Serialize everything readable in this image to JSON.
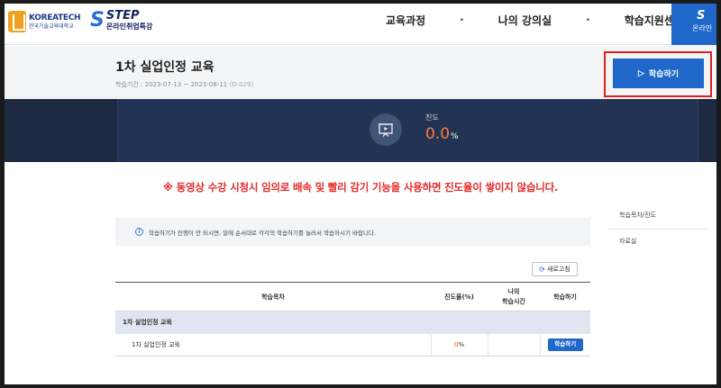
{
  "header": {
    "brand1_en": "KOREATECH",
    "brand1_ko": "한국기술교육대학교",
    "brand2_en": "STEP",
    "brand2_ko": "온라인취업특강",
    "nav": [
      "교육과정",
      "·",
      "나의 강의실",
      "·",
      "학습지원센터"
    ],
    "aside_label": "온라인"
  },
  "course": {
    "title": "1차 실업인정 교육",
    "period": "학습기간 : 2023-07-13 ~ 2023-08-11",
    "dday": "(D-029)",
    "study_button": "학습하기"
  },
  "progress": {
    "label": "진도",
    "value": "0.0",
    "unit": "%"
  },
  "notice": {
    "warning": "※ 동영상 수강 시청시 임의로 배속 및 빨리 감기 기능을 사용하면 진도율이 쌓이지 않습니다.",
    "info": "학습하기가 진행이 안 되시면, 밑에 순서대로 각각의 학습하기를 눌러서 학습하시기 바랍니다."
  },
  "side_menu": [
    "학습목차/진도",
    "자료실"
  ],
  "toc": {
    "refresh": "새로고침",
    "columns": {
      "title": "학습목차",
      "rate": "진도율(%)",
      "time_line1": "나의",
      "time_line2": "학습시간",
      "action": "학습하기"
    },
    "group": "1차 실업인정 교육",
    "rows": [
      {
        "title": "1차 실업인정 교육",
        "rate": "0",
        "rate_unit": "%",
        "time": "",
        "button": "학습하기"
      }
    ]
  },
  "colors": {
    "accent": "#1f67c9",
    "warning": "#e52b2b",
    "progress_value": "#ff7a3d",
    "band": "#1d2a42"
  }
}
